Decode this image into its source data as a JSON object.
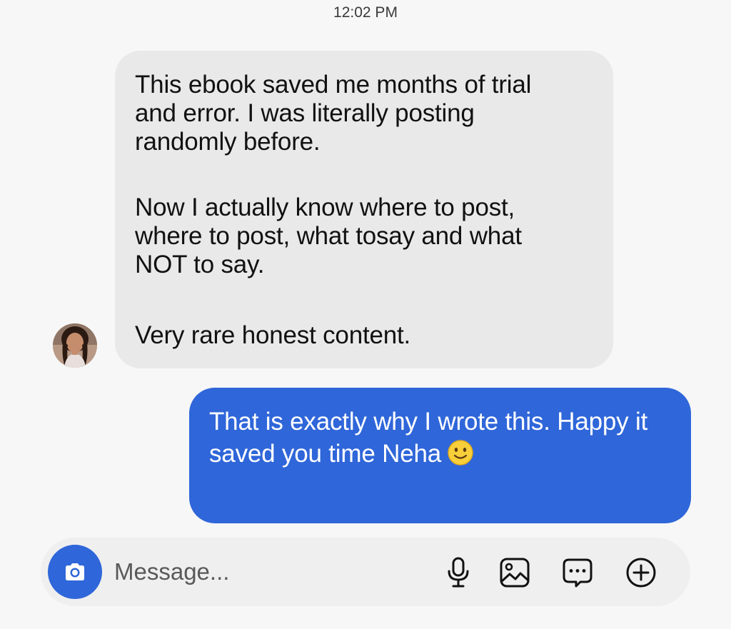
{
  "chat": {
    "timestamp": "12:02 PM",
    "incoming": {
      "paragraphs": [
        "This ebook saved me months of trial\nand error. I was literally posting\nrandomly before.",
        "Now I actually know where to post,\nwhere to post, what tosay and what\nNOT to say.",
        "Very rare honest content."
      ],
      "avatar_icon": "user-avatar"
    },
    "outgoing": {
      "text": "That is exactly why I wrote this. Happy it saved you time Neha",
      "emoji_icon": "slightly-smiling-face"
    }
  },
  "composer": {
    "placeholder": "Message...",
    "icons": [
      "camera-icon",
      "microphone-icon",
      "image-icon",
      "sticker-icon",
      "plus-circle-icon"
    ]
  },
  "colors": {
    "background": "#f7f7f7",
    "incoming_bubble": "#e9e9e9",
    "outgoing_bubble": "#2f66d9",
    "accent": "#2f66d9",
    "composer_bg": "#efefef"
  }
}
